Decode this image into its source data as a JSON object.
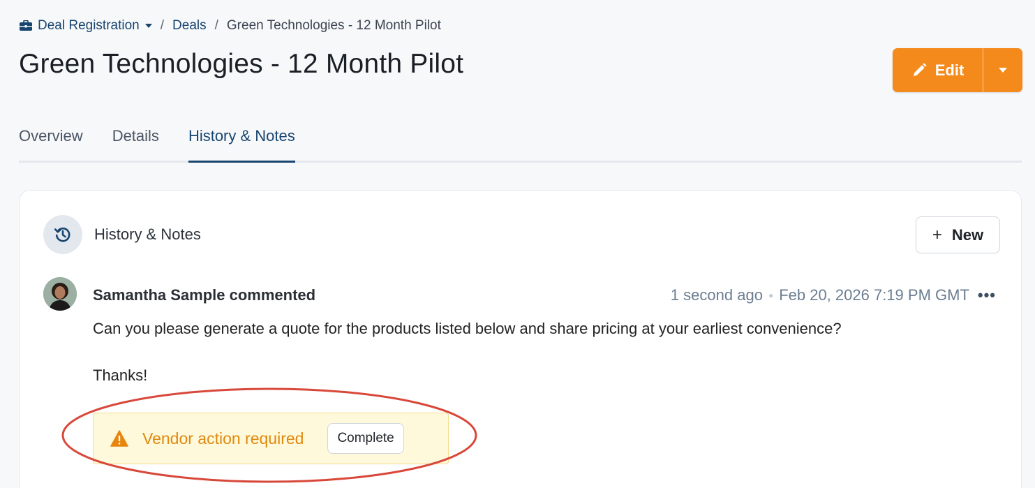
{
  "breadcrumb": {
    "section": "Deal Registration",
    "deals": "Deals",
    "current": "Green Technologies - 12 Month Pilot"
  },
  "page_title": "Green Technologies - 12 Month Pilot",
  "edit_button": {
    "label": "Edit"
  },
  "tabs": [
    {
      "label": "Overview",
      "active": false
    },
    {
      "label": "Details",
      "active": false
    },
    {
      "label": "History & Notes",
      "active": true
    }
  ],
  "card": {
    "title": "History & Notes",
    "new_button": {
      "icon": "+",
      "label": "New"
    }
  },
  "comment": {
    "author": "Samantha Sample commented",
    "relative_time": "1 second ago",
    "timestamp": "Feb 20, 2026 7:19 PM GMT",
    "more": "•••",
    "body": "Can you please generate a quote for the products listed below and share pricing at your earliest convenience?",
    "signoff": "Thanks!",
    "vendor_action": {
      "label": "Vendor action required",
      "complete_button": "Complete"
    }
  },
  "colors": {
    "accent_orange": "#f48a1c",
    "navy": "#17456f",
    "warning": "#e0890e",
    "highlight_ring": "#d8483a"
  }
}
